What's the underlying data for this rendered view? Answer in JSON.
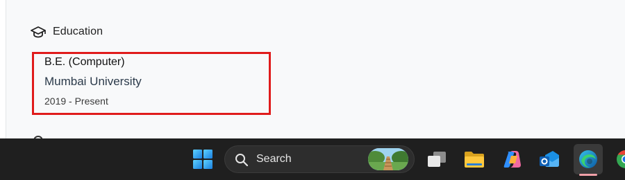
{
  "education": {
    "section_title": "Education",
    "icon": "graduation-cap-icon",
    "highlight_color": "#e01b1b",
    "entries": [
      {
        "degree": "B.E. (Computer)",
        "institution": "Mumbai University",
        "period": "2019 - Present"
      }
    ]
  },
  "taskbar": {
    "search_label": "Search",
    "apps": [
      {
        "name": "start",
        "icon": "windows-logo-icon"
      },
      {
        "name": "task-view",
        "icon": "task-view-icon"
      },
      {
        "name": "file-explorer",
        "icon": "folder-icon"
      },
      {
        "name": "copilot",
        "icon": "copilot-icon"
      },
      {
        "name": "outlook",
        "icon": "outlook-icon"
      },
      {
        "name": "edge",
        "icon": "edge-icon",
        "active": true
      },
      {
        "name": "chrome",
        "icon": "chrome-icon"
      }
    ]
  }
}
